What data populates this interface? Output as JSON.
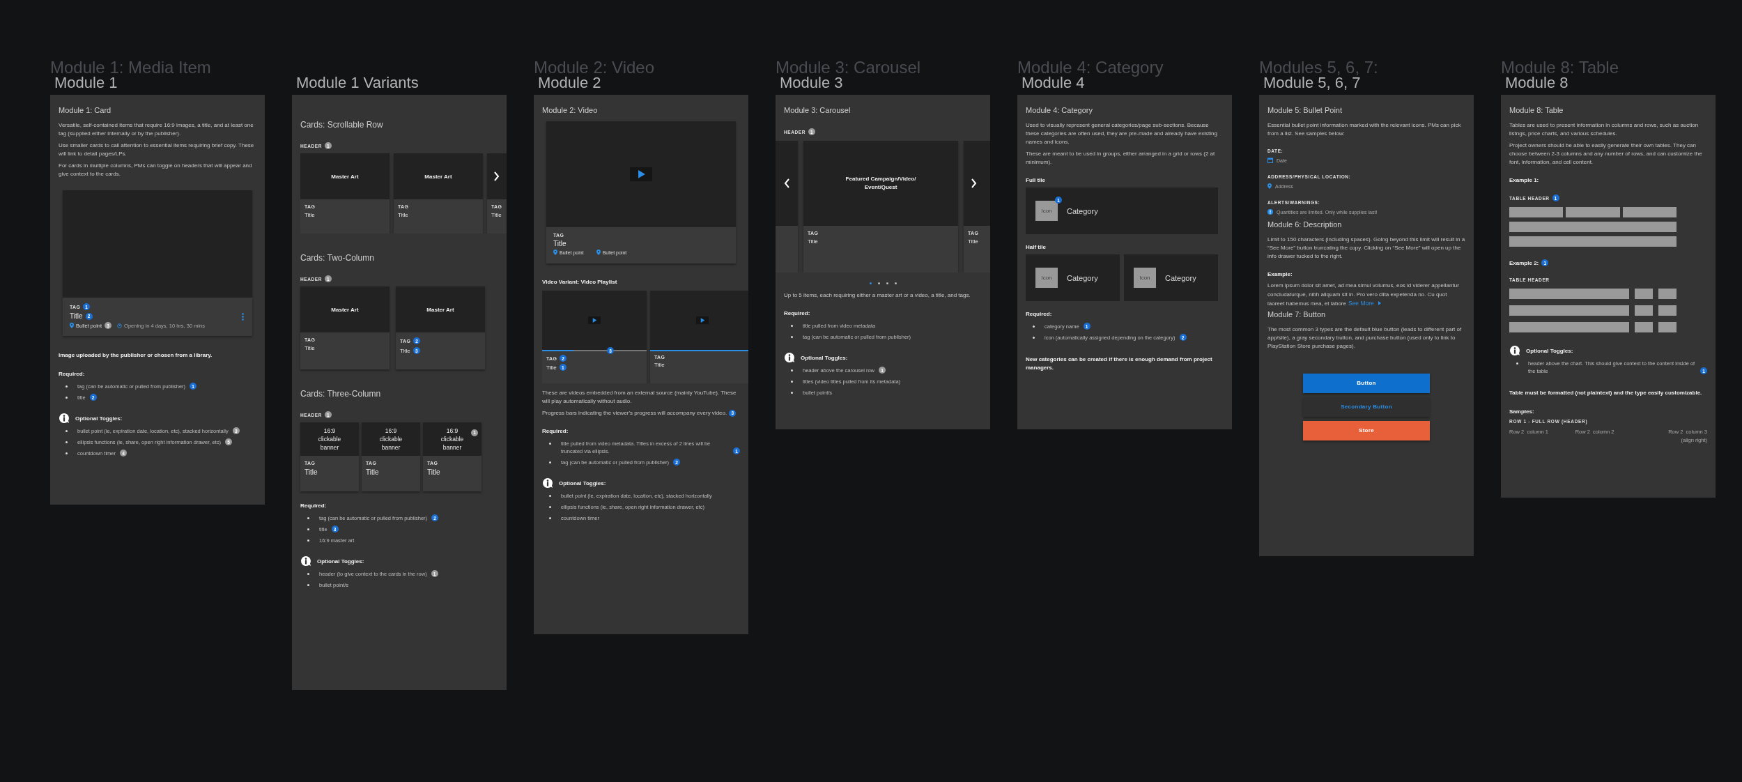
{
  "columns": [
    {
      "ghost_title": "Module 1: Media Item",
      "title": "Module 1",
      "blocks": [
        {
          "kind": "heading",
          "text": "Module 1: Card"
        },
        {
          "kind": "para",
          "text": "Versatile, self-contained items that require 16:9 images, a title, and at least one tag (supplied either internally or by the publisher)."
        },
        {
          "kind": "para",
          "text": "Use smaller cards to call attention to essential items requiring brief copy. These will link to detail pages/LPs."
        },
        {
          "kind": "para",
          "text": "For cards in multiple columns, PMs can toggle on headers that will appear and give context to the cards."
        },
        {
          "kind": "media_card",
          "tag": {
            "text": "TAG",
            "badges": [
              {
                "text": "1",
                "color": "#1a6fd4"
              }
            ]
          },
          "title": {
            "text": "Title",
            "badges": [
              {
                "text": "2",
                "color": "#1a6fd4"
              }
            ]
          },
          "bullet": {
            "text": "Bullet point",
            "badges": [
              {
                "text": "3",
                "color": "#9b9b9b"
              }
            ]
          },
          "timer": {
            "text": "Opening in 4 days, 10 hrs, 30 mins"
          }
        },
        {
          "kind": "bold",
          "text": "Image uploaded by the publisher or chosen from a library."
        },
        {
          "kind": "label",
          "text": "Required:"
        },
        {
          "kind": "list",
          "items": [
            {
              "text": "tag (can be automatic or pulled from publisher)",
              "badges": [
                {
                  "text": "1",
                  "color": "#1a6fd4"
                }
              ]
            },
            {
              "text": "title",
              "badges": [
                {
                  "text": "2",
                  "color": "#1a6fd4"
                }
              ]
            }
          ]
        },
        {
          "kind": "toggles",
          "title": "Optional Toggles:",
          "items": [
            {
              "text": "bullet point (ie, expiration date, location, etc), stacked horizontally",
              "badges": [
                {
                  "text": "3",
                  "color": "#9b9b9b"
                }
              ]
            },
            {
              "text": "ellipsis functions (ie, share, open right information drawer, etc)",
              "badges": [
                {
                  "text": "5",
                  "color": "#9b9b9b"
                }
              ]
            },
            {
              "text": "countdown timer",
              "badges": [
                {
                  "text": "4",
                  "color": "#9b9b9b"
                }
              ]
            }
          ]
        }
      ]
    },
    {
      "title": "Module 1 Variants",
      "blocks": [
        {
          "kind": "subheading",
          "text": "Cards: Scrollable Row"
        },
        {
          "kind": "caps",
          "text": "HEADER",
          "badges": [
            {
              "text": "1",
              "color": "#9b9b9b"
            }
          ]
        },
        {
          "kind": "scroll_row",
          "cards": [
            {
              "art": "Master Art",
              "tag": {
                "text": "TAG"
              },
              "title": {
                "text": "Title"
              }
            },
            {
              "art": "Master Art",
              "tag": {
                "text": "TAG"
              },
              "title": {
                "text": "Title"
              }
            },
            {
              "tag": {
                "text": "TAG"
              },
              "title": {
                "text": "Title"
              }
            }
          ]
        },
        {
          "kind": "subheading",
          "text": "Cards: Two-Column"
        },
        {
          "kind": "caps",
          "text": "HEADER",
          "badges": [
            {
              "text": "1",
              "color": "#9b9b9b"
            }
          ]
        },
        {
          "kind": "two_column_row",
          "cards": [
            {
              "art": "Master Art",
              "tag": {
                "text": "TAG"
              },
              "title": {
                "text": "Title"
              }
            },
            {
              "art": "Master Art",
              "tag": {
                "text": "TAG",
                "badges": [
                  {
                    "text": "2",
                    "color": "#1a6fd4"
                  }
                ]
              },
              "title": {
                "text": "Title",
                "badges": [
                  {
                    "text": "3",
                    "color": "#1a6fd4"
                  }
                ]
              }
            }
          ]
        },
        {
          "kind": "subheading",
          "text": "Cards: Three-Column"
        },
        {
          "kind": "caps",
          "text": "HEADER",
          "badges": [
            {
              "text": "1",
              "color": "#9b9b9b"
            }
          ]
        },
        {
          "kind": "three_column_row",
          "cards": [
            {
              "art": "16:9 clickable banner",
              "tag": {
                "text": "TAG"
              },
              "title": {
                "text": "Title"
              }
            },
            {
              "art": "16:9 clickable banner",
              "tag": {
                "text": "TAG"
              },
              "title": {
                "text": "Title"
              }
            },
            {
              "art": "16:9 clickable banner",
              "art_badges": [
                {
                  "text": "1",
                  "color": "#9b9b9b"
                }
              ],
              "tag": {
                "text": "TAG"
              },
              "title": {
                "text": "Title"
              }
            }
          ]
        },
        {
          "kind": "label",
          "text": "Required:"
        },
        {
          "kind": "list",
          "items": [
            {
              "text": "tag (can be automatic or pulled from publisher)",
              "badges": [
                {
                  "text": "2",
                  "color": "#1a6fd4"
                }
              ]
            },
            {
              "text": "title",
              "badges": [
                {
                  "text": "3",
                  "color": "#1a6fd4"
                }
              ]
            },
            {
              "text": "16:9 master art"
            }
          ]
        },
        {
          "kind": "toggles",
          "title": "Optional Toggles:",
          "items": [
            {
              "text": "header (to give context to the cards in the row)",
              "badges": [
                {
                  "text": "1",
                  "color": "#9b9b9b"
                }
              ]
            },
            {
              "text": "bullet point/s"
            }
          ]
        }
      ]
    },
    {
      "ghost_title": "Module 2: Video",
      "title": "Module 2",
      "blocks": [
        {
          "kind": "heading",
          "text": "Module 2: Video"
        },
        {
          "kind": "video",
          "tag": {
            "text": "TAG"
          },
          "title": {
            "text": "Title"
          },
          "bullets": [
            {
              "text": "Bullet point"
            },
            {
              "text": "Bullet point"
            }
          ]
        },
        {
          "kind": "label",
          "text": "Video Variant: Video Playlist"
        },
        {
          "kind": "playlist",
          "items": [
            {
              "tag": {
                "text": "TAG",
                "badges": [
                  {
                    "text": "2",
                    "color": "#1a6fd4"
                  }
                ]
              },
              "title": {
                "text": "Title",
                "badges": [
                  {
                    "text": "1",
                    "color": "#1a6fd4"
                  }
                ]
              },
              "level": 0.3,
              "progress_badges": [
                {
                  "text": "3",
                  "color": "#1a6fd4"
                }
              ]
            },
            {
              "tag": {
                "text": "TAG"
              },
              "title": {
                "text": "Title"
              },
              "level": 1
            }
          ]
        },
        {
          "kind": "para",
          "text": "These are videos embedded from an external source (mainly YouTube). These will play automatically without audio."
        },
        {
          "kind": "para",
          "text": "Progress bars indicating the viewer's progress will accompany every video.",
          "badges": [
            {
              "text": "3",
              "color": "#1a6fd4"
            }
          ]
        },
        {
          "kind": "label",
          "text": "Required:"
        },
        {
          "kind": "list",
          "items": [
            {
              "text": "title pulled from video metadata. Titles in excess of 2 lines will be truncated via ellipsis.",
              "badges": [
                {
                  "text": "1",
                  "color": "#1a6fd4"
                }
              ]
            },
            {
              "text": "tag (can be automatic or pulled from publisher)",
              "badges": [
                {
                  "text": "2",
                  "color": "#1a6fd4"
                }
              ]
            }
          ]
        },
        {
          "kind": "toggles",
          "title": "Optional Toggles:",
          "items": [
            {
              "text": "bullet point (ie, expiration date, location, etc), stacked horizontally"
            },
            {
              "text": "ellipsis functions (ie, share, open right information drawer, etc)"
            },
            {
              "text": "countdown timer"
            }
          ]
        }
      ]
    },
    {
      "ghost_title": "Module 3: Carousel",
      "title": "Module 3",
      "blocks": [
        {
          "kind": "heading",
          "text": "Module 3: Carousel"
        },
        {
          "kind": "caps",
          "text": "HEADER",
          "badges": [
            {
              "text": "1",
              "color": "#9b9b9b"
            }
          ]
        },
        {
          "kind": "carousel",
          "feature": "Featured Campaign/Video/ Event/Quest",
          "tag": {
            "text": "TAG"
          },
          "title": {
            "text": "Title"
          },
          "next": {
            "tag": {
              "text": "TAG"
            },
            "title": {
              "text": "Title"
            }
          }
        },
        {
          "kind": "pager",
          "dots": [
            {
              "selected": true
            },
            {
              "selected": false
            },
            {
              "selected": false
            },
            {
              "selected": false
            }
          ]
        },
        {
          "kind": "para",
          "text": "Up to 5 items, each requiring either a master art or a video, a title, and tags."
        },
        {
          "kind": "label",
          "text": "Required:"
        },
        {
          "kind": "list",
          "items": [
            {
              "text": "title pulled from video metadata"
            },
            {
              "text": "tag (can be automatic or pulled from publisher)"
            }
          ]
        },
        {
          "kind": "toggles",
          "title": "Optional Toggles:",
          "items": [
            {
              "text": "header above the carousel row",
              "badges": [
                {
                  "text": "1",
                  "color": "#9b9b9b"
                }
              ]
            },
            {
              "text": "titles (video titles pulled from its metadata)"
            },
            {
              "text": "bullet point/s"
            }
          ]
        }
      ]
    },
    {
      "ghost_title": "Module 4: Category",
      "title": "Module 4",
      "blocks": [
        {
          "kind": "heading",
          "text": "Module 4: Category"
        },
        {
          "kind": "para",
          "text": "Used to visually represent general categories/page sub-sections. Because these categories are often used, they are pre-made and already have existing names and icons."
        },
        {
          "kind": "para",
          "text": "These are meant to be used in groups, either arranged in a grid or rows (2 at minimum)."
        },
        {
          "kind": "label",
          "text": "Full tile"
        },
        {
          "kind": "full_tiles",
          "tiles": [
            {
              "icon": "Icon",
              "name": "Category",
              "badges": [
                {
                  "text": "1",
                  "color": "#1a6fd4"
                }
              ]
            }
          ]
        },
        {
          "kind": "label",
          "text": "Half tile"
        },
        {
          "kind": "half_tiles",
          "tiles": [
            {
              "icon": "Icon",
              "name": "Category"
            },
            {
              "icon": "Icon",
              "name": "Category"
            }
          ]
        },
        {
          "kind": "label",
          "text": "Required:"
        },
        {
          "kind": "list",
          "items": [
            {
              "text": "category name",
              "badges": [
                {
                  "text": "1",
                  "color": "#1a6fd4"
                }
              ]
            },
            {
              "text": "icon (automatically assigned depending on the category)",
              "badges": [
                {
                  "text": "2",
                  "color": "#1a6fd4"
                }
              ]
            }
          ]
        },
        {
          "kind": "bold",
          "text": "New categories can be created if there is enough demand from project managers."
        }
      ]
    },
    {
      "ghost_title": "Modules 5, 6, 7:",
      "title": "Module 5, 6, 7",
      "blocks": [
        {
          "kind": "heading",
          "text": "Module 5: Bullet Point"
        },
        {
          "kind": "para",
          "text": "Essential bullet point information marked with the relevant icons. PMs can pick from a list. See samples below:"
        },
        {
          "kind": "caps",
          "text": "DATE:"
        },
        {
          "kind": "date_bullet",
          "text": "Date"
        },
        {
          "kind": "caps",
          "text": "ADDRESS/PHYSICAL LOCATION:"
        },
        {
          "kind": "location_bullet",
          "text": "Address"
        },
        {
          "kind": "caps",
          "text": "ALERTS/WARNINGS:"
        },
        {
          "kind": "alert_bullet",
          "text": "Quantities are limited. Only while supplies last!"
        },
        {
          "kind": "heading",
          "text": "Module 6: Description"
        },
        {
          "kind": "para",
          "text": "Limit to 150 characters (including spaces). Going beyond this limit will result in a “See More” button truncating the copy. Clicking on “See More” will open up the info drawer tucked to the right."
        },
        {
          "kind": "label",
          "text": "Example:"
        },
        {
          "kind": "see_more",
          "text": "Lorem ipsum dolor sit amet, ad mea simul volumus, eos id viderer appellantur concludaturque, nibh aliquam sit in. Pro vero clita expetenda no. Cu quot laoreet habemus mea, et labore",
          "link": "See More"
        },
        {
          "kind": "heading",
          "text": "Module 7: Button"
        },
        {
          "kind": "para",
          "text": "The most common 3 types are the default blue button (leads to different part of app/site), a gray secondary button, and purchase button (used only to link to PlayStation Store purchase pages)."
        },
        {
          "kind": "primary_button",
          "text": "Button"
        },
        {
          "kind": "secondary_button",
          "text": "Secondary Button"
        },
        {
          "kind": "store_button",
          "text": "Store"
        }
      ]
    },
    {
      "ghost_title": "Module 8: Table",
      "title": "Module 8",
      "blocks": [
        {
          "kind": "heading",
          "text": "Module 8: Table"
        },
        {
          "kind": "para",
          "text": "Tables are used to present information in columns and rows, such as auction listngs, price charts, and various schedules."
        },
        {
          "kind": "para",
          "text": "Project owners should be able to easily generate their own tables. They can choose between 2-3 columns and any number of rows, and can customize the font, information, and cell content."
        },
        {
          "kind": "label",
          "text": "Example 1:"
        },
        {
          "kind": "caps",
          "text": "TABLE HEADER",
          "badges": [
            {
              "text": "1",
              "color": "#1a6fd4"
            }
          ]
        },
        {
          "kind": "even_bars"
        },
        {
          "kind": "label",
          "text": "Example 2:",
          "badges": [
            {
              "text": "1",
              "color": "#1a6fd4"
            }
          ]
        },
        {
          "kind": "caps",
          "text": "TABLE HEADER"
        },
        {
          "kind": "wide_bars"
        },
        {
          "kind": "toggles",
          "title": "Optional Toggles:",
          "items": [
            {
              "text": "header above the chart. This should give context to the content inside of the table",
              "badges": [
                {
                  "text": "1",
                  "color": "#1a6fd4"
                }
              ]
            }
          ]
        },
        {
          "kind": "bold",
          "text": "Table must be formatted (not plaintext) and the type easily customizable."
        },
        {
          "kind": "label",
          "text": "Samples:"
        },
        {
          "kind": "sample_table",
          "header": "ROW 1 - FULL ROW (HEADER)",
          "cells": [
            "Row 2  column 1",
            "Row 2  column 2",
            "Row 2  column 3"
          ],
          "note": "(align right)"
        }
      ]
    }
  ]
}
